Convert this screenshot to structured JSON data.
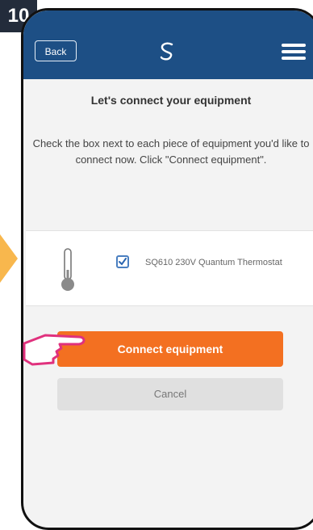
{
  "badge": {
    "step": "10"
  },
  "header": {
    "back_label": "Back",
    "logo_icon": "salus-logo-icon",
    "menu_icon": "hamburger-menu-icon"
  },
  "main": {
    "title": "Let's connect your equipment",
    "description": "Check the box next to each piece of equipment you'd like to connect now. Click \"Connect equipment\"."
  },
  "equipment": [
    {
      "name": "SQ610 230V Quantum Thermostat",
      "checked": true,
      "icon": "thermometer-icon"
    }
  ],
  "buttons": {
    "connect_label": "Connect equipment",
    "cancel_label": "Cancel"
  },
  "colors": {
    "header": "#1d4f85",
    "primary_button": "#f37021",
    "secondary_button": "#e0e0e0",
    "badge": "#232c3b",
    "annotation": "#e0317d"
  }
}
